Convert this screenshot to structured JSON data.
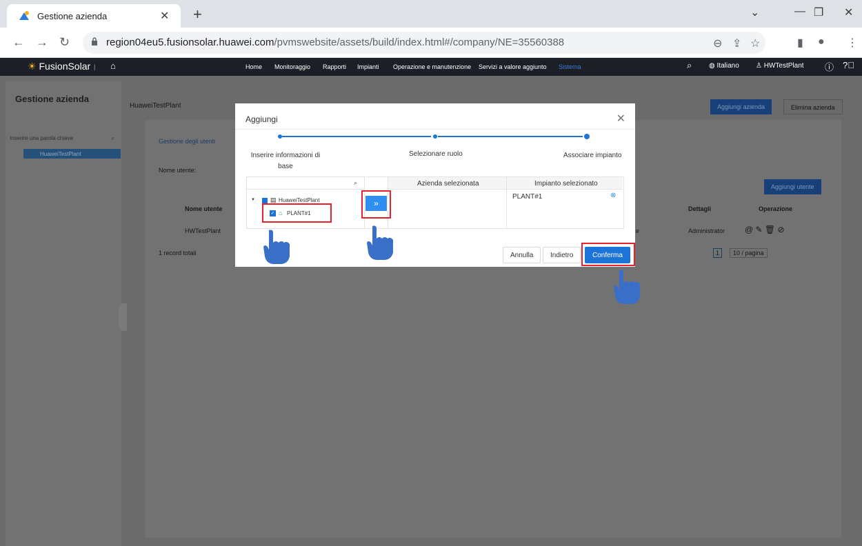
{
  "browser": {
    "tab_title": "Gestione azienda",
    "url_host": "region04eu5.fusionsolar.huawei.com",
    "url_path": "/pvmswebsite/assets/build/index.html#/company/NE=35560388"
  },
  "app": {
    "brand": "FusionSolar",
    "nav": [
      "Home",
      "Monitoraggio",
      "Rapporti",
      "Impianti",
      "Operazione e manutenzione",
      "Servizi a valore aggiunto",
      "Sistema"
    ],
    "language": "Italiano",
    "user": "HWTestPlant"
  },
  "sidebar": {
    "title": "Gestione azienda",
    "search_placeholder": "Inserire una parola chiave",
    "tree_item": "HuaweiTestPlant"
  },
  "page": {
    "company": "HuaweiTestPlant",
    "add_company": "Aggiungi azienda",
    "delete_company": "Elimina azienda",
    "tab_users": "Gestione degli utenti",
    "username_label": "Nome utente:",
    "add_user": "Aggiungi utente",
    "columns": [
      "Nome utente",
      "Dettagli",
      "Operazione"
    ],
    "row": {
      "username": "HWTestPlant",
      "role_tail": "e",
      "details": "Administrator"
    },
    "total": "1 record totali",
    "page_num": "1",
    "page_size": "10 / pagina"
  },
  "modal": {
    "title": "Aggiungi",
    "steps": [
      "Inserire informazioni di base",
      "Selezionare ruolo",
      "Associare impianto"
    ],
    "tree_root": "HuaweiTestPlant",
    "tree_child": "PLANT#1",
    "transfer_symbol": "»",
    "col_company": "Azienda selezionata",
    "col_plant": "Impianto selezionato",
    "selected_plant": "PLANT#1",
    "btn_cancel": "Annulla",
    "btn_back": "Indietro",
    "btn_confirm": "Conferma"
  },
  "colors": {
    "accent": "#1d74d8",
    "header": "#1c1f26",
    "highlight": "#e8202b",
    "hand": "#3a6fc7"
  }
}
